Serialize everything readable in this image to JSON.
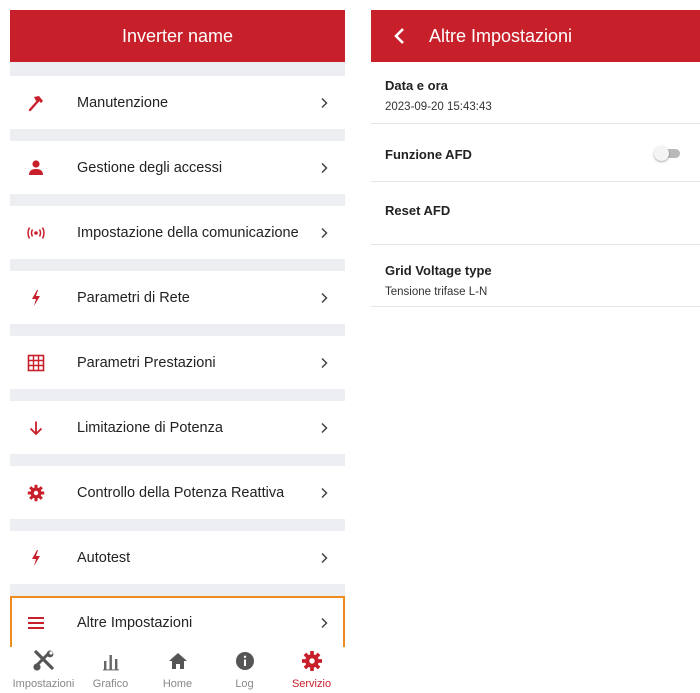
{
  "left": {
    "title": "Inverter name",
    "menu": [
      {
        "label": "Manutenzione",
        "icon": "hammer-icon"
      },
      {
        "label": "Gestione degli accessi",
        "icon": "person-icon"
      },
      {
        "label": "Impostazione della comunicazione",
        "icon": "broadcast-icon"
      },
      {
        "label": "Parametri di Rete",
        "icon": "lightning-icon"
      },
      {
        "label": "Parametri Prestazioni",
        "icon": "grid-icon"
      },
      {
        "label": "Limitazione di Potenza",
        "icon": "arrow-down-icon"
      },
      {
        "label": "Controllo della Potenza Reattiva",
        "icon": "gear-icon"
      },
      {
        "label": "Autotest",
        "icon": "lightning-icon"
      },
      {
        "label": "Altre Impostazioni",
        "icon": "menu-lines-icon"
      }
    ],
    "tabs": [
      {
        "label": "Impostazioni",
        "icon": "tools-icon"
      },
      {
        "label": "Grafico",
        "icon": "bar-chart-icon"
      },
      {
        "label": "Home",
        "icon": "home-icon"
      },
      {
        "label": "Log",
        "icon": "info-icon"
      },
      {
        "label": "Servizio",
        "icon": "gear-icon"
      }
    ],
    "active_tab": "Servizio",
    "selected_item": "Altre Impostazioni"
  },
  "right": {
    "title": "Altre Impostazioni",
    "items": [
      {
        "label": "Data e ora",
        "value": "2023-09-20 15:43:43"
      },
      {
        "label": "Funzione AFD",
        "toggle": "off"
      },
      {
        "label": "Reset AFD"
      },
      {
        "label": "Grid Voltage type",
        "value": "Tensione trifase L-N"
      }
    ]
  },
  "colors": {
    "accent": "#c8202a",
    "highlight": "#f08c1e",
    "separator": "#eceef2"
  }
}
